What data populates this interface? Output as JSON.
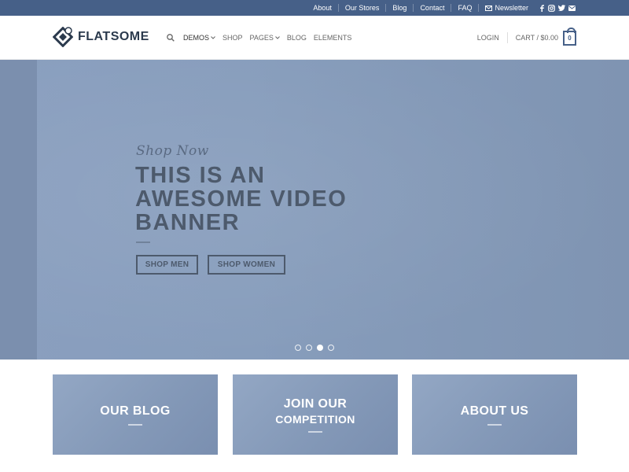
{
  "topbar": {
    "links": [
      "About",
      "Our Stores",
      "Blog",
      "Contact",
      "FAQ"
    ],
    "newsletter_label": "Newsletter",
    "social_icons": [
      "facebook-icon",
      "instagram-icon",
      "twitter-icon",
      "email-icon"
    ]
  },
  "header": {
    "logo_text": "FLATSOME",
    "nav": {
      "demos": "DEMOS",
      "shop": "SHOP",
      "pages": "PAGES",
      "blog": "BLOG",
      "elements": "ELEMENTS"
    },
    "login": "LOGIN",
    "cart_label": "CART / $0.00",
    "cart_count": "0"
  },
  "banner": {
    "kicker": "Shop Now",
    "headline": "THIS IS AN AWESOME VIDEO BANNER",
    "button_men": "SHOP MEN",
    "button_women": "SHOP WOMEN",
    "slides_total": 4,
    "active_slide": 3
  },
  "boxes": {
    "blog": "OUR BLOG",
    "competition_line1": "JOIN OUR",
    "competition_line2": "COMPETITION",
    "about": "ABOUT US"
  },
  "colors": {
    "topbar_bg": "#466088",
    "banner_bg": "#879dbc",
    "text_dark": "#4d5a6c",
    "accent": "#466088"
  }
}
